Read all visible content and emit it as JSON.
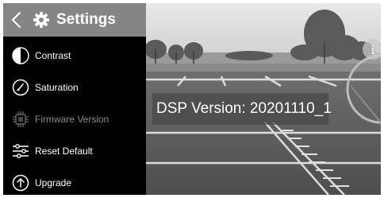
{
  "header": {
    "title": "Settings",
    "back_icon": "chevron-left-icon",
    "title_icon": "gear-icon"
  },
  "menu": {
    "items": [
      {
        "label": "Contrast",
        "icon": "contrast-icon",
        "enabled": true
      },
      {
        "label": "Saturation",
        "icon": "saturation-dial-icon",
        "enabled": true
      },
      {
        "label": "Firmware Version",
        "icon": "chip-icon",
        "enabled": false
      },
      {
        "label": "Reset Default",
        "icon": "sliders-icon",
        "enabled": true
      },
      {
        "label": "Upgrade",
        "icon": "upload-arrow-icon",
        "enabled": true
      }
    ]
  },
  "overlay": {
    "dsp_version": "DSP Version: 20201110_1"
  },
  "info": {
    "icon": "info-icon",
    "glyph": "i"
  },
  "colors": {
    "header_bg": "#858585",
    "panel_bg": "#000000",
    "disabled_text": "#8a8a8a"
  }
}
